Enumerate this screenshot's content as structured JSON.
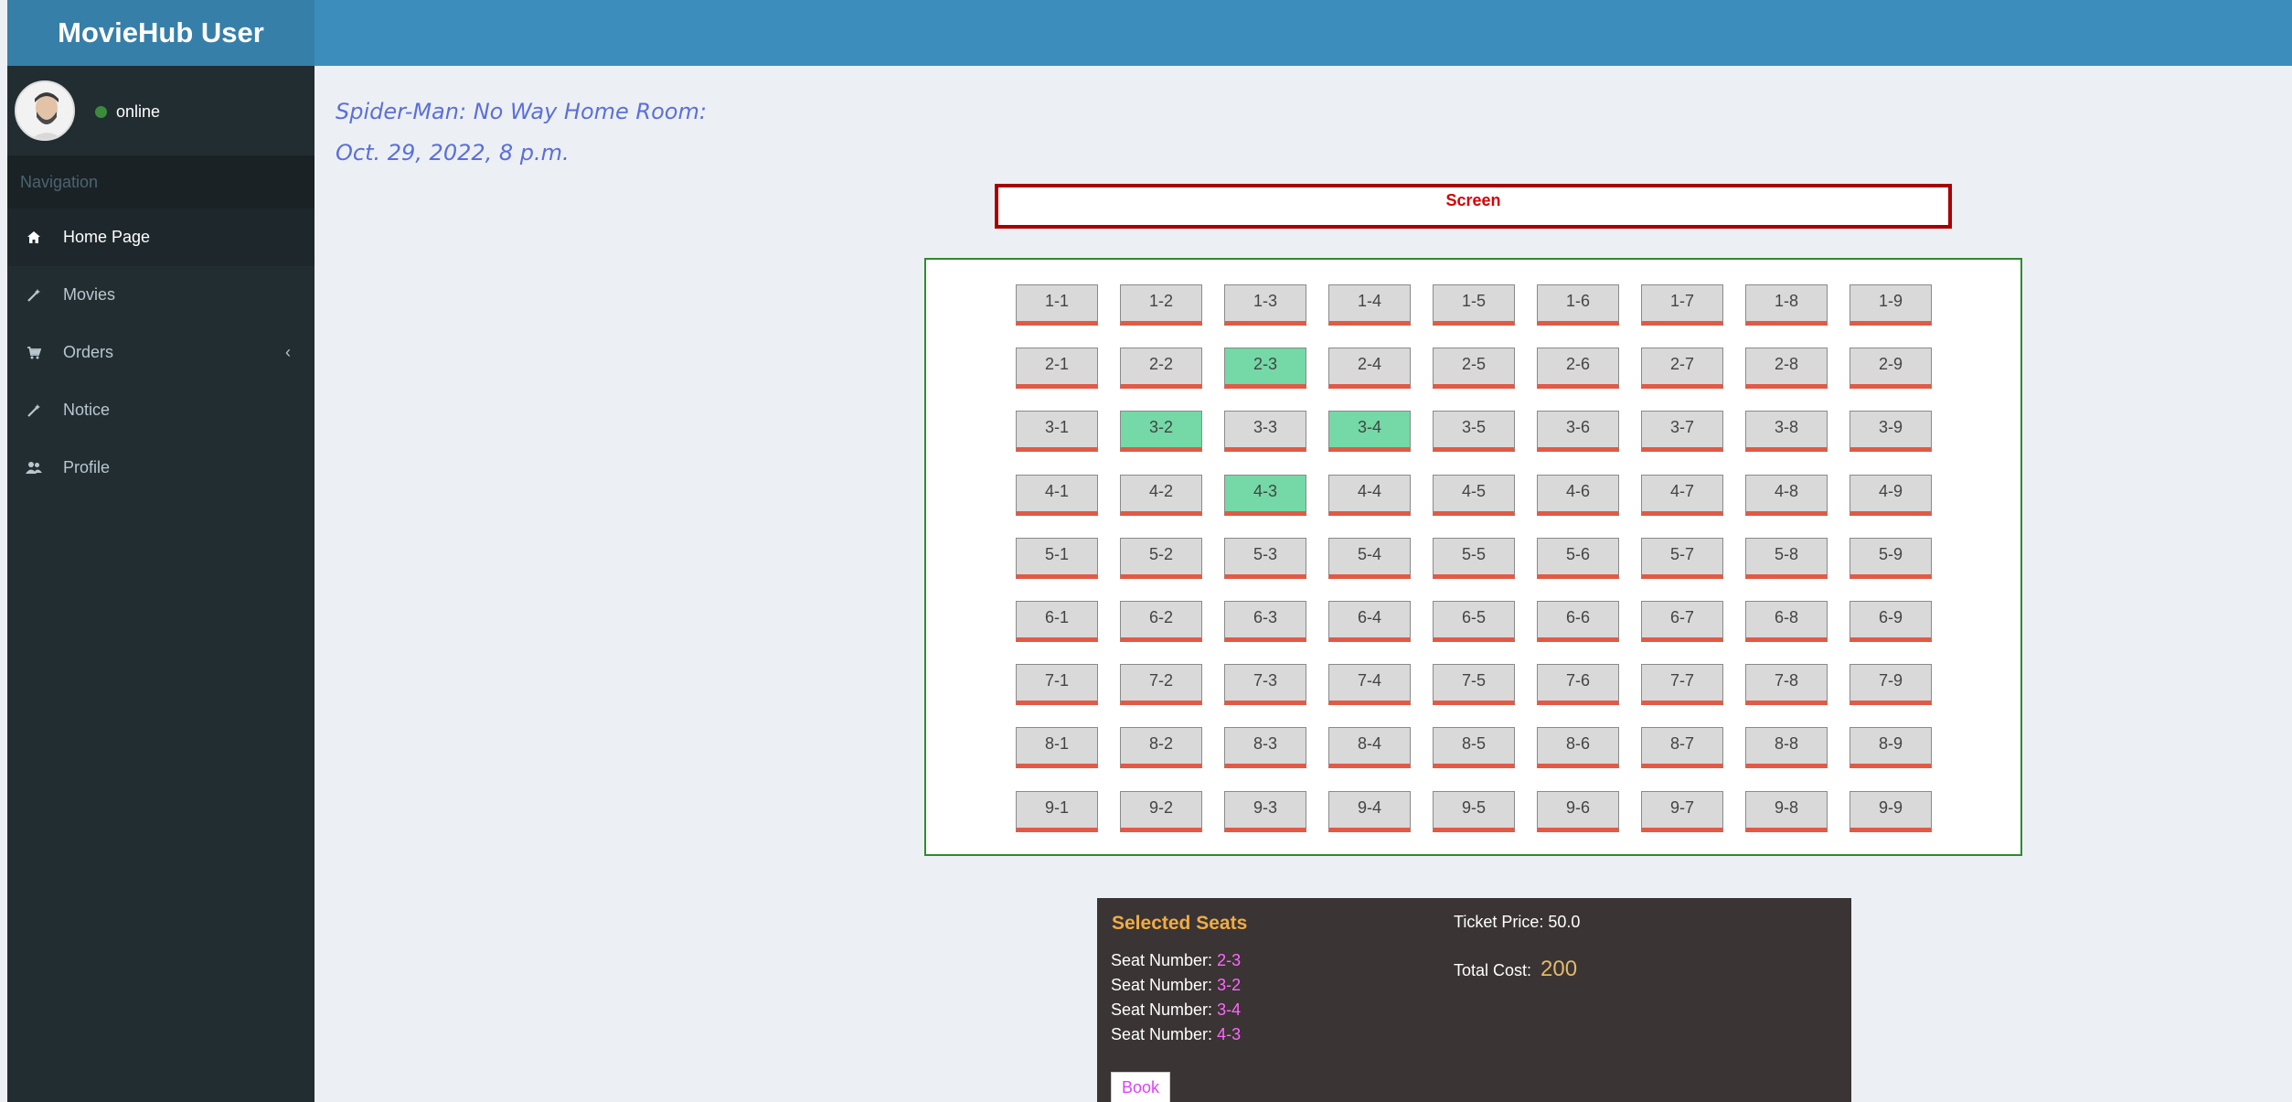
{
  "app": {
    "brand": "MovieHub User"
  },
  "user": {
    "status": "online"
  },
  "sidebar": {
    "header": "Navigation",
    "items": [
      {
        "label": "Home Page",
        "icon": "home-icon",
        "active": true
      },
      {
        "label": "Movies",
        "icon": "magic-wand-icon"
      },
      {
        "label": "Orders",
        "icon": "cart-icon",
        "has_chevron": true
      },
      {
        "label": "Notice",
        "icon": "magic-wand-icon"
      },
      {
        "label": "Profile",
        "icon": "users-icon"
      }
    ]
  },
  "movie": {
    "title_line": "Spider-Man: No Way Home Room:",
    "datetime": "Oct. 29, 2022, 8 p.m."
  },
  "screen": {
    "label": "Screen"
  },
  "seats": {
    "rows": 9,
    "cols": 9,
    "selected": [
      "2-3",
      "3-2",
      "3-4",
      "4-3"
    ]
  },
  "selection": {
    "title": "Selected Seats",
    "seat_label": "Seat Number: ",
    "seats": [
      "2-3",
      "3-2",
      "3-4",
      "4-3"
    ],
    "ticket_price_label": "Ticket Price: ",
    "ticket_price": "50.0",
    "total_cost_label": "Total Cost: ",
    "total_cost": "200",
    "book_label": "Book"
  },
  "colors": {
    "header": "#3c8dbc",
    "sidebar": "#222d32",
    "seat_selected": "#74d9a7",
    "seat_default": "#d9d9d9",
    "screen_border": "#a80000"
  }
}
